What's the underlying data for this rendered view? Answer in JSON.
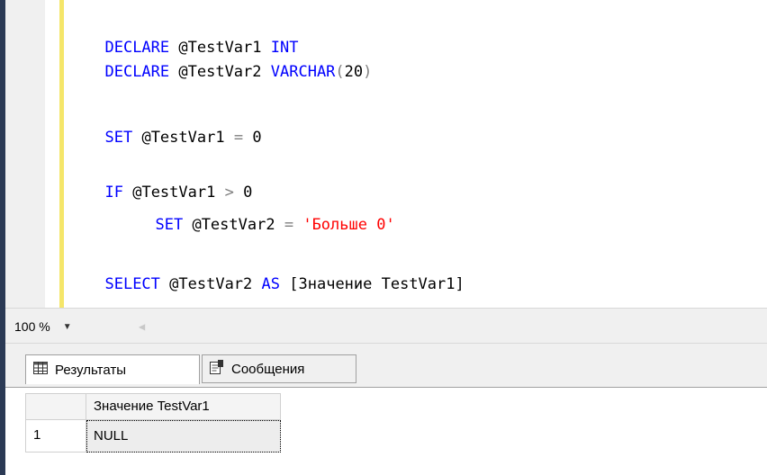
{
  "editor": {
    "lines": {
      "l1": {
        "kw": "DECLARE",
        "var": "@TestVar1",
        "type": "INT"
      },
      "l2": {
        "kw": "DECLARE",
        "var": "@TestVar2",
        "type": "VARCHAR",
        "open": "(",
        "num": "20",
        "close": ")"
      },
      "l3": {
        "kw": "SET",
        "var": "@TestVar1",
        "op": "=",
        "num": "0"
      },
      "l4": {
        "kw": "IF",
        "var": "@TestVar1",
        "op": ">",
        "num": "0"
      },
      "l5": {
        "kw": "SET",
        "var": "@TestVar2",
        "op": "=",
        "str": "'Больше 0'"
      },
      "l6": {
        "kw1": "SELECT",
        "var": "@TestVar2",
        "kw2": "AS",
        "alias": "[Значение TestVar1]"
      }
    }
  },
  "zoom": {
    "value": "100 %",
    "arrow_icon": "chevron-down-icon",
    "scroll_icon": "scroll-left-icon"
  },
  "tabs": {
    "results": {
      "label": "Результаты",
      "icon": "grid-icon"
    },
    "messages": {
      "label": "Сообщения",
      "icon": "messages-icon"
    }
  },
  "grid": {
    "columns": [
      "Значение TestVar1"
    ],
    "rows": [
      {
        "num": "1",
        "cells": [
          "NULL"
        ]
      }
    ]
  },
  "colors": {
    "keyword": "#0000ff",
    "string": "#ff0000",
    "operator": "#808080",
    "change_bar": "#f5e66a"
  }
}
